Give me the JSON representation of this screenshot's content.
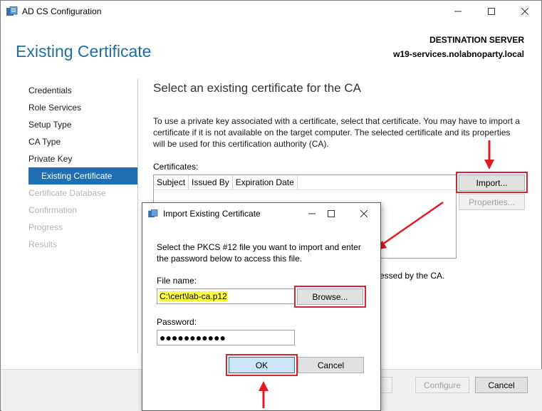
{
  "window": {
    "title": "AD CS Configuration"
  },
  "header": {
    "page_title": "Existing Certificate",
    "destination_label": "DESTINATION SERVER",
    "destination_server": "w19-services.nolabnoparty.local"
  },
  "sidebar": {
    "items": [
      {
        "label": "Credentials",
        "state": "normal"
      },
      {
        "label": "Role Services",
        "state": "normal"
      },
      {
        "label": "Setup Type",
        "state": "normal"
      },
      {
        "label": "CA Type",
        "state": "normal"
      },
      {
        "label": "Private Key",
        "state": "normal"
      },
      {
        "label": "Existing Certificate",
        "state": "active"
      },
      {
        "label": "Certificate Database",
        "state": "disabled"
      },
      {
        "label": "Confirmation",
        "state": "disabled"
      },
      {
        "label": "Progress",
        "state": "disabled"
      },
      {
        "label": "Results",
        "state": "disabled"
      }
    ]
  },
  "main": {
    "section_title": "Select an existing certificate for the CA",
    "intro": "To use a private key associated with a certificate, select that certificate. You may have to import a certificate if it is not available on the target computer. The selected certificate and its properties will be used for this certification authority (CA).",
    "certificates_label": "Certificates:",
    "columns": [
      "Subject",
      "Issued By",
      "Expiration Date"
    ],
    "import_button": "Import...",
    "properties_button": "Properties...",
    "access_text_fragment": "ccessed by the CA."
  },
  "footer": {
    "configure_button": "Configure",
    "cancel_button": "Cancel"
  },
  "dialog": {
    "title": "Import Existing Certificate",
    "instructions": "Select the PKCS #12 file you want to import and enter the password below to access this file.",
    "file_name_label": "File name:",
    "file_name_value": "C:\\cert\\lab-ca.p12",
    "browse_button": "Browse...",
    "password_label": "Password:",
    "password_value": "●●●●●●●●●●●",
    "ok_button": "OK",
    "cancel_button": "Cancel"
  },
  "colors": {
    "accent": "#1f6fb2",
    "heading": "#1f6e9e",
    "annotation_red": "#d22630",
    "highlight_yellow": "#ffff3a"
  }
}
